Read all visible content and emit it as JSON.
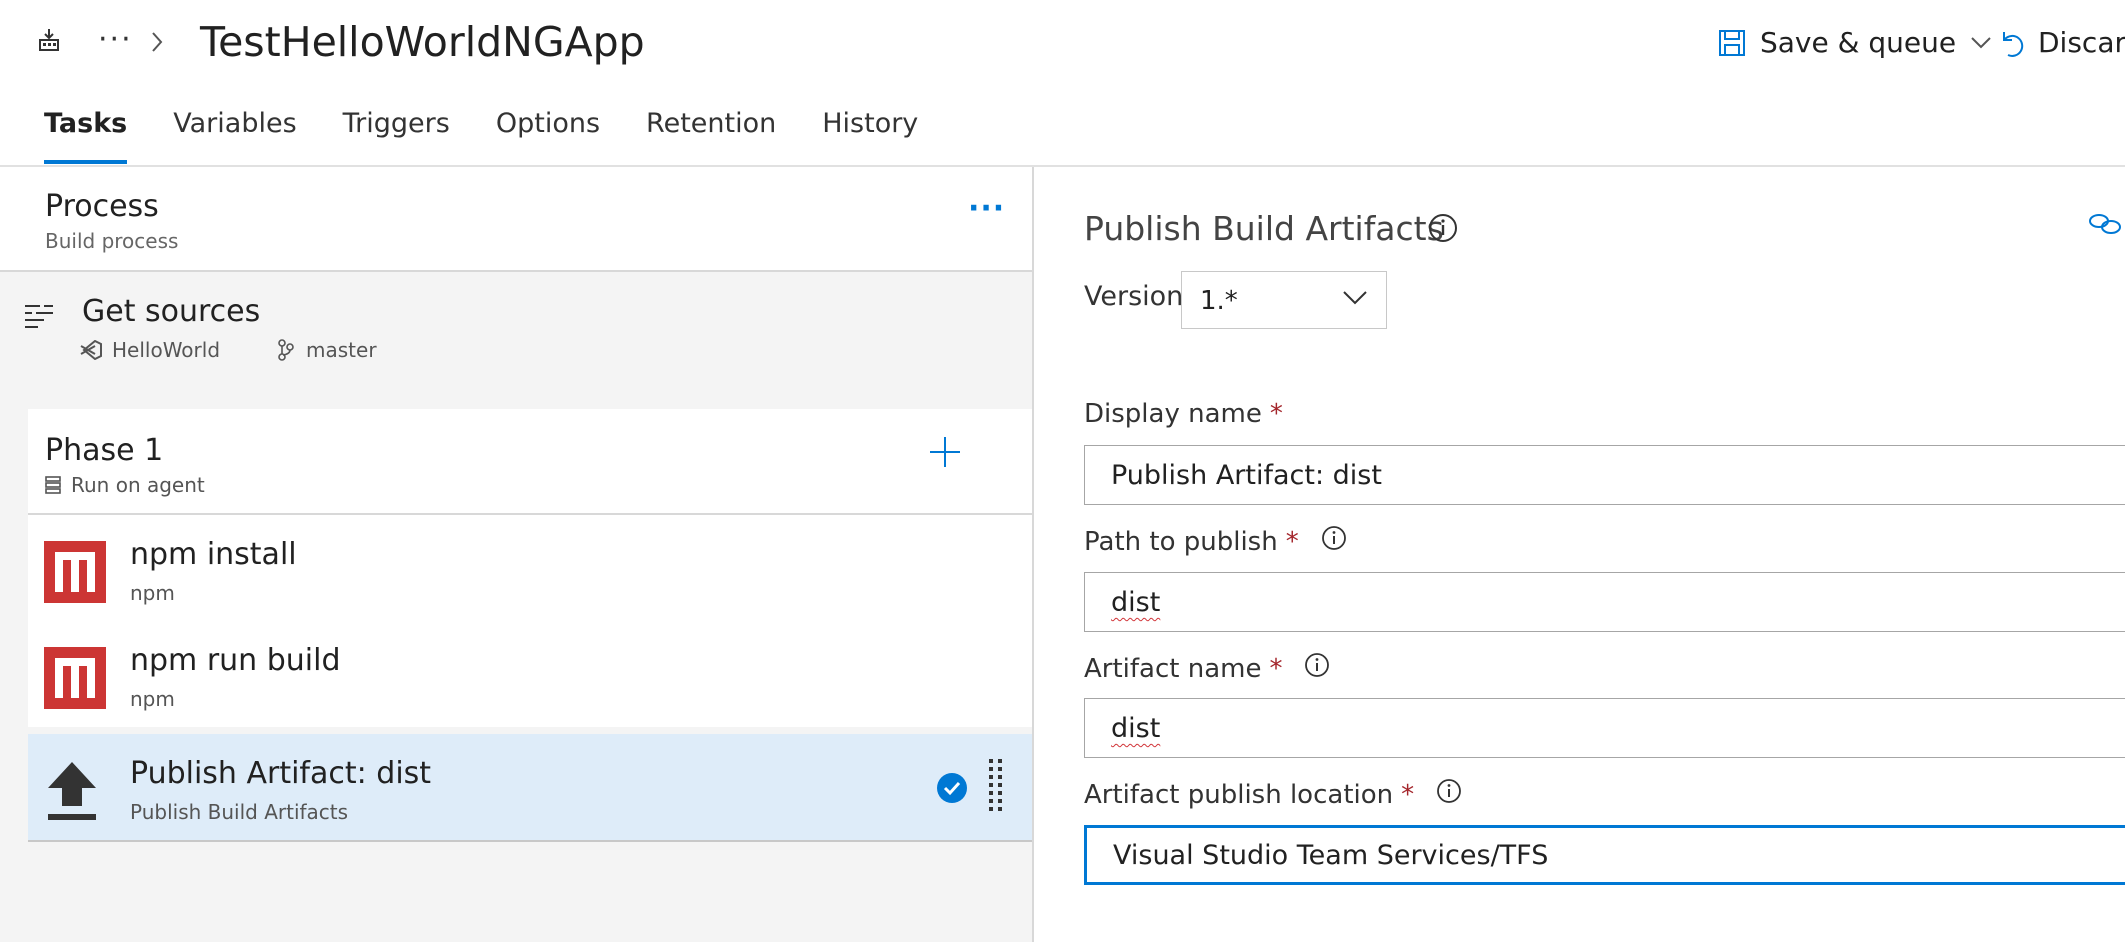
{
  "header": {
    "title": "TestHelloWorldNGApp",
    "breadcrumb_more": "···",
    "save_queue_label": "Save & queue",
    "discard_label": "Discard"
  },
  "tabs": [
    {
      "label": "Tasks",
      "active": true
    },
    {
      "label": "Variables"
    },
    {
      "label": "Triggers"
    },
    {
      "label": "Options"
    },
    {
      "label": "Retention"
    },
    {
      "label": "History"
    }
  ],
  "process": {
    "title": "Process",
    "subtitle": "Build process",
    "more": "···"
  },
  "get_sources": {
    "title": "Get sources",
    "repo": "HelloWorld",
    "branch": "master"
  },
  "phase": {
    "title": "Phase 1",
    "subtitle": "Run on agent"
  },
  "tasks": [
    {
      "name": "npm install",
      "type": "npm"
    },
    {
      "name": "npm run build",
      "type": "npm"
    },
    {
      "name": "Publish Artifact: dist",
      "type": "Publish Build Artifacts"
    }
  ],
  "details": {
    "title": "Publish Build Artifacts",
    "version_label": "Version",
    "version_value": "1.*",
    "fields": [
      {
        "label": "Display name",
        "value": "Publish Artifact: dist"
      },
      {
        "label": "Path to publish",
        "value": "dist"
      },
      {
        "label": "Artifact name",
        "value": "dist"
      },
      {
        "label": "Artifact publish location",
        "value": "Visual Studio Team Services/TFS"
      }
    ]
  },
  "colors": {
    "accent": "#0078d4",
    "required": "#a4262c",
    "npm_red": "#cc3534",
    "selected_bg": "#deecf9"
  }
}
